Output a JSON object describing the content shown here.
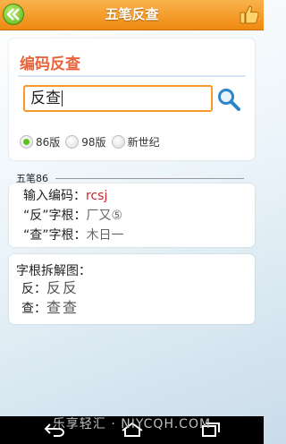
{
  "app": {
    "title": "五笔反查"
  },
  "search": {
    "heading": "编码反查",
    "input_value": "反查",
    "versions": [
      {
        "label": "86版",
        "checked": true
      },
      {
        "label": "98版",
        "checked": false
      },
      {
        "label": "新世纪",
        "checked": false
      }
    ]
  },
  "result": {
    "section_label": "五笔86",
    "code_label": "输入编码：",
    "code_value": "rcsj",
    "rows": [
      {
        "label": "“反”字根：",
        "roots": "厂又⑤"
      },
      {
        "label": "“查”字根：",
        "roots": "木日一"
      }
    ]
  },
  "decomposition": {
    "title": "字根拆解图：",
    "rows": [
      {
        "char_label": "反：",
        "glyphs": "反反"
      },
      {
        "char_label": "查：",
        "glyphs": "查查"
      }
    ]
  },
  "watermark": "乐享轻汇 · NIYCQH.COM",
  "icons": [
    "back-arrow-icon",
    "thumbs-up-icon",
    "search-icon",
    "back-nav-icon",
    "home-nav-icon",
    "recent-apps-icon"
  ],
  "colors": {
    "accent_orange": "#f08a12",
    "heading": "#e8623b",
    "code_red": "#c8262d",
    "radio_green": "#5cc21a"
  }
}
